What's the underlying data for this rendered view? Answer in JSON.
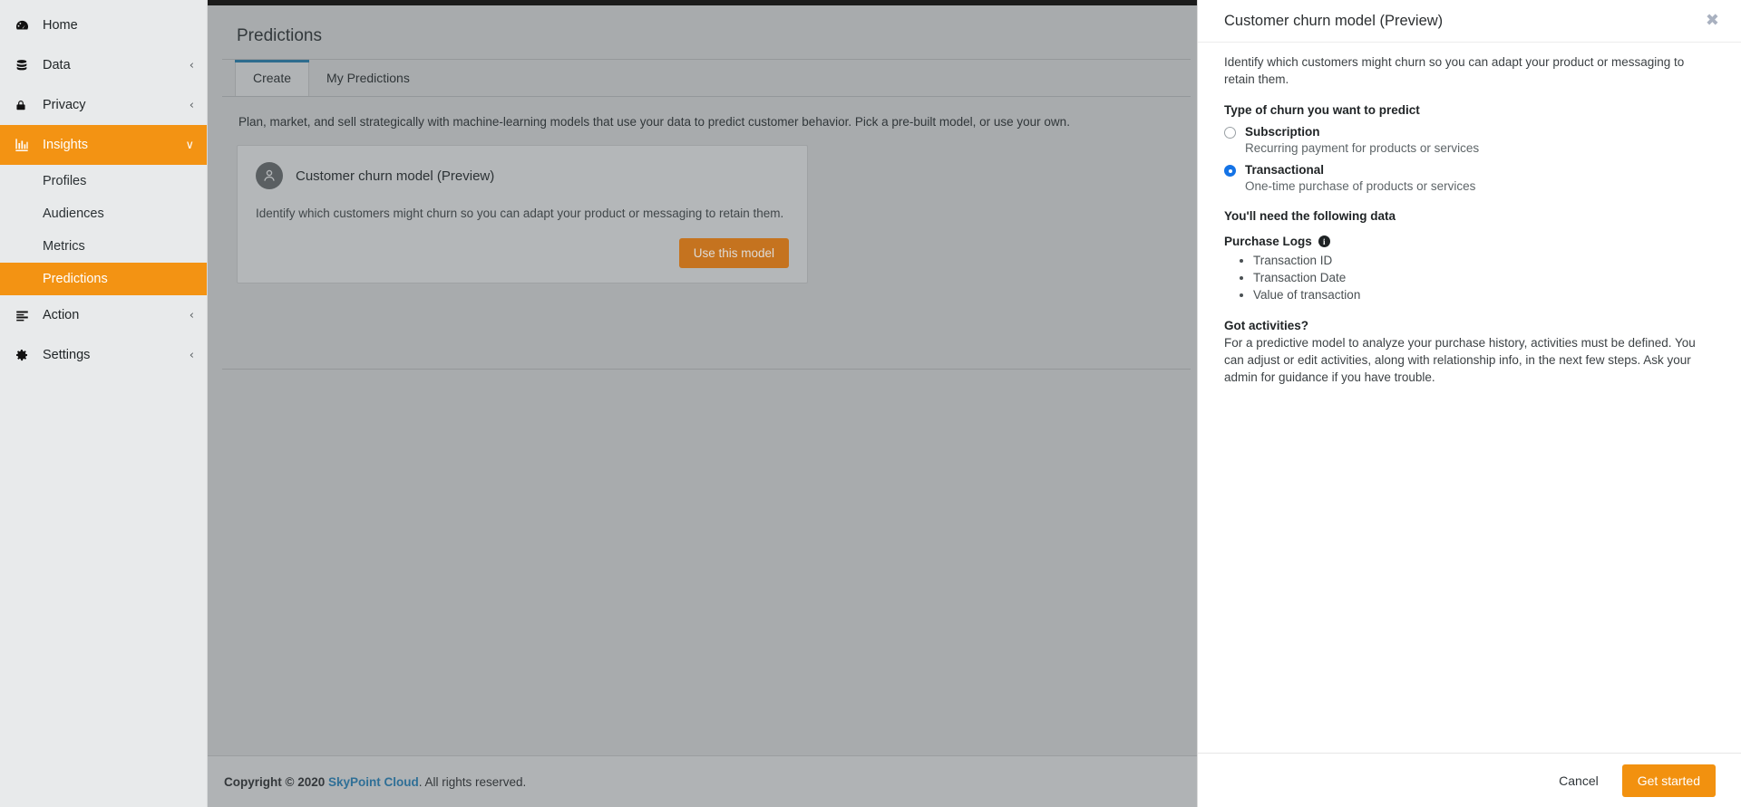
{
  "theme": {
    "accent_orange": "#f39313",
    "primary_button": "#f2910f",
    "tab_underline": "#2e6c8e",
    "link_blue": "#2f6f96",
    "radio_selected": "#1473e6",
    "sidebar_bg": "#e8eaeb",
    "overlay_bg": "#a8abad"
  },
  "sidebar": {
    "items": [
      {
        "label": "Home",
        "icon": "dashboard-icon",
        "chevron": "",
        "active": false,
        "sub": false
      },
      {
        "label": "Data",
        "icon": "database-icon",
        "chevron": "‹",
        "active": false,
        "sub": false
      },
      {
        "label": "Privacy",
        "icon": "lock-icon",
        "chevron": "‹",
        "active": false,
        "sub": false
      },
      {
        "label": "Insights",
        "icon": "bar-chart-icon",
        "chevron": "∨",
        "active": true,
        "sub": false
      },
      {
        "label": "Profiles",
        "icon": "",
        "chevron": "",
        "active": false,
        "sub": true
      },
      {
        "label": "Audiences",
        "icon": "",
        "chevron": "",
        "active": false,
        "sub": true
      },
      {
        "label": "Metrics",
        "icon": "",
        "chevron": "",
        "active": false,
        "sub": true
      },
      {
        "label": "Predictions",
        "icon": "",
        "chevron": "",
        "active": true,
        "sub": true
      },
      {
        "label": "Action",
        "icon": "list-icon",
        "chevron": "‹",
        "active": false,
        "sub": false
      },
      {
        "label": "Settings",
        "icon": "gear-icon",
        "chevron": "‹",
        "active": false,
        "sub": false
      }
    ]
  },
  "page": {
    "title": "Predictions",
    "tabs": [
      {
        "label": "Create",
        "active": true
      },
      {
        "label": "My Predictions",
        "active": false
      }
    ],
    "intro": "Plan, market, and sell strategically with machine-learning models that use your data to predict customer behavior. Pick a pre-built model, or use your own.",
    "card": {
      "avatar_icon": "user-avatar-icon",
      "name": "Customer churn model (Preview)",
      "description": "Identify which customers might churn so you can adapt your product or messaging to retain them.",
      "button_label": "Use this model"
    }
  },
  "footer": {
    "copyright_prefix": "Copyright © 2020 ",
    "brand": "SkyPoint Cloud",
    "copyright_suffix": ". All rights reserved."
  },
  "modal": {
    "title": "Customer churn model (Preview)",
    "close_icon": "close-icon",
    "intro": "Identify which customers might churn so you can adapt your product or messaging to retain them.",
    "churn_type_heading": "Type of churn you want to predict",
    "options": [
      {
        "label": "Subscription",
        "description": "Recurring payment for products or services",
        "selected": false
      },
      {
        "label": "Transactional",
        "description": "One-time purchase of products or services",
        "selected": true
      }
    ],
    "data_heading": "You'll need the following data",
    "data_group_label": "Purchase Logs",
    "data_group_info_icon": "info-icon",
    "data_items": [
      "Transaction ID",
      "Transaction Date",
      "Value of transaction"
    ],
    "activities_heading": "Got activities?",
    "activities_text": "For a predictive model to analyze your purchase history, activities must be defined. You can adjust or edit activities, along with relationship info, in the next few steps. Ask your admin for guidance if you have trouble.",
    "cancel_label": "Cancel",
    "primary_label": "Get started"
  }
}
